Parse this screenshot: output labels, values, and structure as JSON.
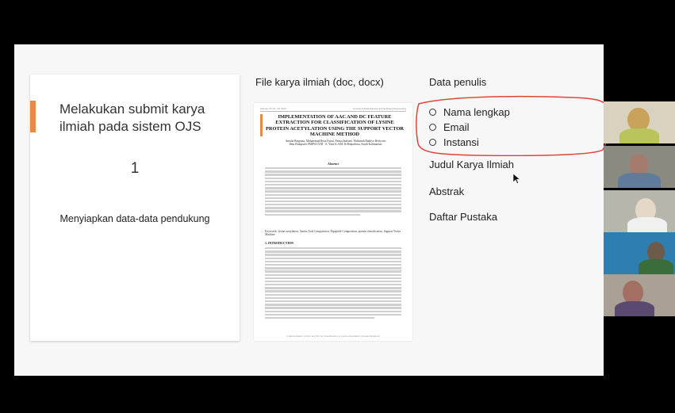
{
  "slide": {
    "left_card": {
      "title": "Melakukan submit karya ilmiah pada sistem OJS",
      "step_number": "1",
      "subtitle": "Menyiapkan data-data pendukung"
    },
    "document": {
      "header": "File karya ilmiah (doc, docx)",
      "meta_left": "Volume XX No. XX 20XX",
      "meta_right": "Journal of Data Science and Software Engineering",
      "paper_title": "IMPLEMENTATION OF AAC AND DC FEATURE EXTRACTION FOR CLASSIFICATION OF LYSINE PROTEIN ACETYLATION USING THE SUPPORT VECTOR MACHINE METHOD",
      "authors": "Amalia Ringiana, Muhammad Reza Faisal, Fatma Indriani, Mohamdi Radityo Heriyono",
      "affiliation": "Ilmu Komputer FMIPA ULM · A. Yani St. KM 36 Banjarbaru, South Kalimantan",
      "abstract_title": "Abstract",
      "keywords": "Keywords: lysine acetylation, Amino Acid Composition, Dipeptide Composition, protein classification, Support Vector Machine",
      "section_title": "1.  INTRODUCTION",
      "footer": "Implementation of AAC and DC for Classification of Lysine Acetylation (Amalia Ringiana)"
    },
    "data_penulis": {
      "title": "Data penulis",
      "items": [
        "Nama lengkap",
        "Email",
        "Instansi"
      ]
    },
    "other_items": [
      "Judul Karya Ilmiah",
      "Abstrak",
      "Daftar Pustaka"
    ],
    "accent_color": "#e8894a",
    "annotation_color": "#e0453a"
  },
  "participants": [
    {
      "head": "#c8a25a",
      "body": "#b9c45a",
      "bg": "#d8d2bf"
    },
    {
      "head": "#a57b6e",
      "body": "#5f7c9a",
      "bg": "#8a8a80"
    },
    {
      "head": "#e6d8c8",
      "body": "#f0f0f0",
      "bg": "#b7b6ad"
    },
    {
      "head": "#6c5a4a",
      "body": "#3a6d3a",
      "bg": "#2e7fb0"
    },
    {
      "head": "#a36f63",
      "body": "#5a4a70",
      "bg": "#a9a195"
    }
  ]
}
